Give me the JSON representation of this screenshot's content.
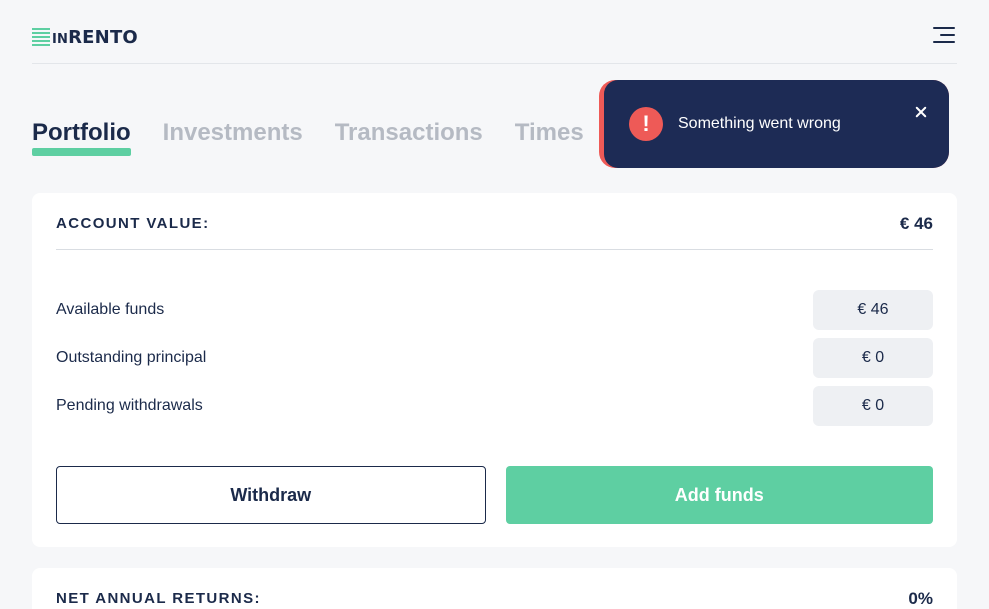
{
  "header": {
    "logo_text": "INRENTO",
    "logo_prefix": "IN",
    "logo_suffix": "RENTO",
    "menu_icon": "hamburger-menu-icon"
  },
  "tabs": [
    {
      "label": "Portfolio",
      "active": true
    },
    {
      "label": "Investments",
      "active": false
    },
    {
      "label": "Transactions",
      "active": false
    },
    {
      "label": "Times",
      "active": false
    }
  ],
  "toast": {
    "message": "Something went wrong",
    "icon": "exclamation-icon",
    "icon_glyph": "!",
    "close_icon": "close-icon",
    "colors": {
      "background": "#1d2b55",
      "accent": "#ee5a57"
    }
  },
  "account": {
    "title": "ACCOUNT VALUE:",
    "value": "€ 46",
    "rows": [
      {
        "label": "Available funds",
        "value": "€ 46"
      },
      {
        "label": "Outstanding principal",
        "value": "€ 0"
      },
      {
        "label": "Pending withdrawals",
        "value": "€ 0"
      }
    ],
    "withdraw_label": "Withdraw",
    "add_funds_label": "Add funds"
  },
  "returns": {
    "title": "NET ANNUAL RETURNS:",
    "value": "0%"
  },
  "colors": {
    "brand_green": "#5ecfa2",
    "text_dark": "#1b2a4a",
    "tab_inactive": "#b5bac3"
  }
}
